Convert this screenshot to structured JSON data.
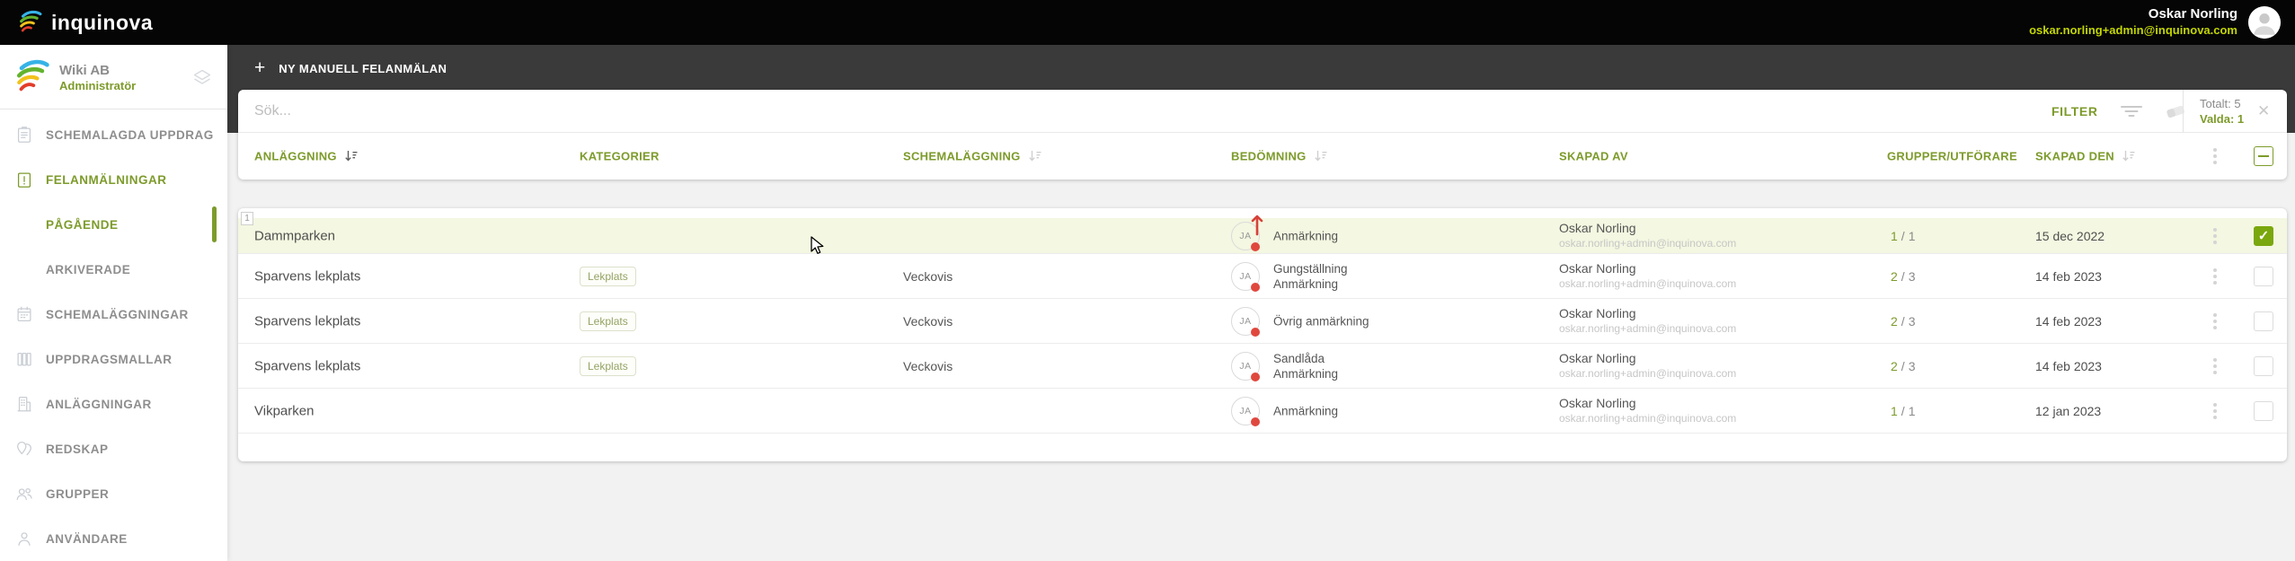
{
  "colors": {
    "accent": "#7d9b2b",
    "accent_bright": "#c3d600",
    "checkbox_checked": "#7aa70d",
    "alert_red": "#e0483e",
    "selected_row_bg": "#f4f7e1",
    "topbar_bg": "#050505",
    "toolbar_bg": "#3a3a3a"
  },
  "topbar": {
    "logo_text": "inquinova",
    "user_name": "Oskar Norling",
    "user_email": "oskar.norling+admin@inquinova.com"
  },
  "sidebar": {
    "org_name": "Wiki AB",
    "org_role": "Administratör",
    "items": [
      {
        "label": "SCHEMALAGDA UPPDRAG",
        "icon": "clipboard-list-icon",
        "type": "main",
        "active": false,
        "indicator": false
      },
      {
        "label": "FELANMÄLNINGAR",
        "icon": "clipboard-alert-icon",
        "type": "main",
        "active": true,
        "indicator": false
      },
      {
        "label": "PÅGÅENDE",
        "icon": null,
        "type": "sub",
        "active": true,
        "indicator": true
      },
      {
        "label": "ARKIVERADE",
        "icon": null,
        "type": "sub",
        "active": false,
        "indicator": false
      },
      {
        "label": "SCHEMALÄGGNINGAR",
        "icon": "calendar-icon",
        "type": "main",
        "active": false,
        "indicator": false
      },
      {
        "label": "UPPDRAGSMALLAR",
        "icon": "template-columns-icon",
        "type": "main",
        "active": false,
        "indicator": false
      },
      {
        "label": "ANLÄGGNINGAR",
        "icon": "building-icon",
        "type": "main",
        "active": false,
        "indicator": false
      },
      {
        "label": "REDSKAP",
        "icon": "map-pin-icon",
        "type": "main",
        "active": false,
        "indicator": false
      },
      {
        "label": "GRUPPER",
        "icon": "users-icon",
        "type": "main",
        "active": false,
        "indicator": false
      },
      {
        "label": "ANVÄNDARE",
        "icon": "user-icon",
        "type": "main",
        "active": false,
        "indicator": false
      }
    ]
  },
  "toolbar": {
    "new_button_label": "NY MANUELL FELANMÄLAN"
  },
  "filterbar": {
    "search_placeholder": "Sök...",
    "filter_label": "FILTER",
    "totals_label": "Totalt:",
    "totals_value": "5",
    "selected_label": "Valda:",
    "selected_value": "1"
  },
  "table": {
    "grupp_separator": "/",
    "headers": [
      {
        "label": "ANLÄGGNING",
        "sort": "dark"
      },
      {
        "label": "KATEGORIER",
        "sort": null
      },
      {
        "label": "SCHEMALÄGGNING",
        "sort": "light"
      },
      {
        "label": "BEDÖMNING",
        "sort": "light"
      },
      {
        "label": "SKAPAD AV",
        "sort": null
      },
      {
        "label": "GRUPPER/UTFÖRARE",
        "sort": null
      },
      {
        "label": "SKAPAD DEN",
        "sort": "light"
      }
    ],
    "rows": [
      {
        "anlaggning": "Dammparken",
        "kategori": "",
        "schemalaggning": "",
        "status": "JA",
        "bedomning": [
          "Anmärkning"
        ],
        "skapad_av": "Oskar Norling",
        "skapad_av_email": "oskar.norling+admin@inquinova.com",
        "grupp_done": "1",
        "grupp_total": "1",
        "skapad_den": "15 dec 2022",
        "selected": true,
        "selection_badge": "1",
        "trend_up": true
      },
      {
        "anlaggning": "Sparvens lekplats",
        "kategori": "Lekplats",
        "schemalaggning": "Veckovis",
        "status": "JA",
        "bedomning": [
          "Gungställning",
          "Anmärkning"
        ],
        "skapad_av": "Oskar Norling",
        "skapad_av_email": "oskar.norling+admin@inquinova.com",
        "grupp_done": "2",
        "grupp_total": "3",
        "skapad_den": "14 feb 2023",
        "selected": false,
        "selection_badge": "",
        "trend_up": false
      },
      {
        "anlaggning": "Sparvens lekplats",
        "kategori": "Lekplats",
        "schemalaggning": "Veckovis",
        "status": "JA",
        "bedomning": [
          "Övrig anmärkning"
        ],
        "skapad_av": "Oskar Norling",
        "skapad_av_email": "oskar.norling+admin@inquinova.com",
        "grupp_done": "2",
        "grupp_total": "3",
        "skapad_den": "14 feb 2023",
        "selected": false,
        "selection_badge": "",
        "trend_up": false
      },
      {
        "anlaggning": "Sparvens lekplats",
        "kategori": "Lekplats",
        "schemalaggning": "Veckovis",
        "status": "JA",
        "bedomning": [
          "Sandlåda",
          "Anmärkning"
        ],
        "skapad_av": "Oskar Norling",
        "skapad_av_email": "oskar.norling+admin@inquinova.com",
        "grupp_done": "2",
        "grupp_total": "3",
        "skapad_den": "14 feb 2023",
        "selected": false,
        "selection_badge": "",
        "trend_up": false
      },
      {
        "anlaggning": "Vikparken",
        "kategori": "",
        "schemalaggning": "",
        "status": "JA",
        "bedomning": [
          "Anmärkning"
        ],
        "skapad_av": "Oskar Norling",
        "skapad_av_email": "oskar.norling+admin@inquinova.com",
        "grupp_done": "1",
        "grupp_total": "1",
        "skapad_den": "12 jan 2023",
        "selected": false,
        "selection_badge": "",
        "trend_up": false
      }
    ]
  }
}
